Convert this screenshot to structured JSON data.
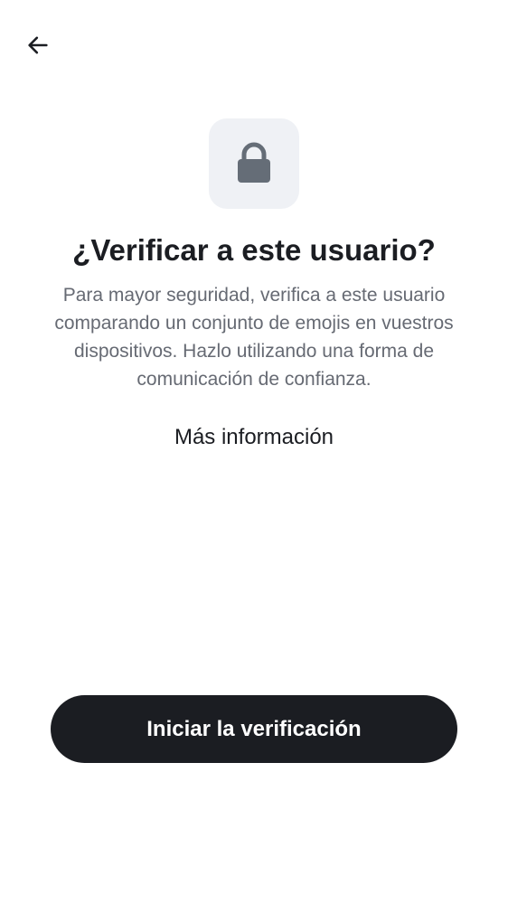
{
  "header": {
    "back_icon": "arrow-left-icon"
  },
  "hero": {
    "icon": "lock-icon",
    "icon_color": "#656d77",
    "tile_color": "#eff1f5"
  },
  "content": {
    "title": "¿Verificar a este usuario?",
    "description": "Para mayor seguridad, verifica a este usuario comparando un conjunto de emojis en vuestros dispositivos. Hazlo utilizando una forma de comunicación de confianza.",
    "learn_more": "Más información"
  },
  "footer": {
    "primary_button": "Iniciar la verificación",
    "primary_button_color": "#1b1d22"
  }
}
